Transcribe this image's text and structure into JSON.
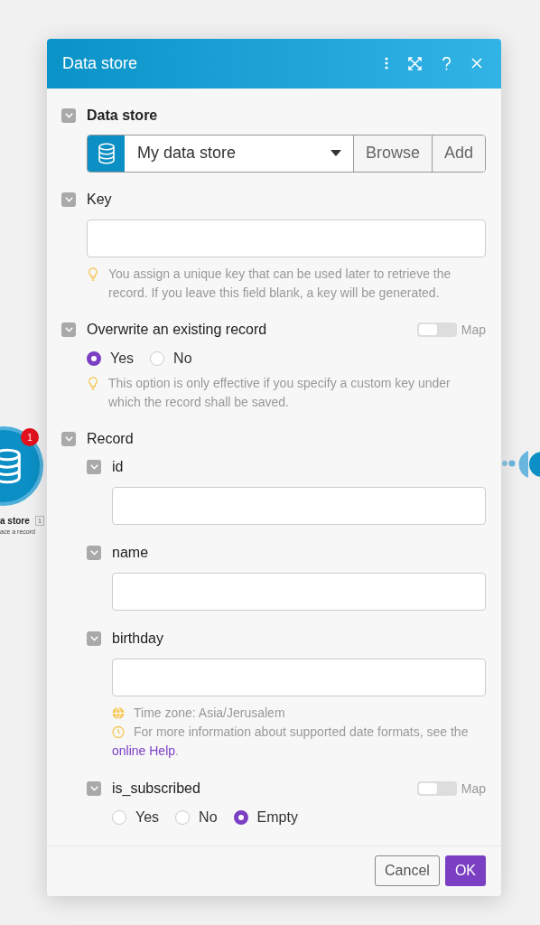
{
  "window": {
    "title": "Data store"
  },
  "canvas": {
    "node": {
      "badge": "1",
      "label": "a store",
      "number": "1",
      "sublabel": "ace a record"
    }
  },
  "fields": [
    {
      "kind": "select",
      "label": "Data store",
      "expanded": true,
      "value": "My data store",
      "buttons": [
        "Browse",
        "Add"
      ]
    },
    {
      "kind": "text",
      "label": "Key",
      "expanded": true,
      "hints": [
        {
          "kind": "tip",
          "text": "You assign a unique key that can be used later to retrieve the record. If you leave this field blank, a key will be generated."
        }
      ]
    },
    {
      "kind": "radio",
      "label": "Overwrite an existing record",
      "expanded": true,
      "map": {
        "label": "Map",
        "on": false
      },
      "options": [
        {
          "label": "Yes",
          "selected": true
        },
        {
          "label": "No",
          "selected": false
        }
      ],
      "hints": [
        {
          "kind": "tip",
          "text": "This option is only effective if you specify a custom key under which the record shall be saved."
        }
      ]
    },
    {
      "kind": "group",
      "label": "Record",
      "expanded": true,
      "children": [
        {
          "kind": "text",
          "label": "id",
          "expanded": true
        },
        {
          "kind": "text",
          "label": "name",
          "expanded": true
        },
        {
          "kind": "text",
          "label": "birthday",
          "expanded": true,
          "hints": [
            {
              "kind": "timezone",
              "text": "Time zone: Asia/Jerusalem"
            },
            {
              "kind": "info",
              "text": "For more information about supported date formats, see the",
              "link": "online Help",
              "after": "."
            }
          ]
        },
        {
          "kind": "radio",
          "label": "is_subscribed",
          "expanded": true,
          "map": {
            "label": "Map",
            "on": false
          },
          "options": [
            {
              "label": "Yes",
              "selected": false
            },
            {
              "label": "No",
              "selected": false
            },
            {
              "label": "Empty",
              "selected": true
            }
          ]
        }
      ]
    }
  ],
  "buttons": [
    {
      "label": "Cancel",
      "kind": "secondary"
    },
    {
      "label": "OK",
      "kind": "primary"
    }
  ]
}
